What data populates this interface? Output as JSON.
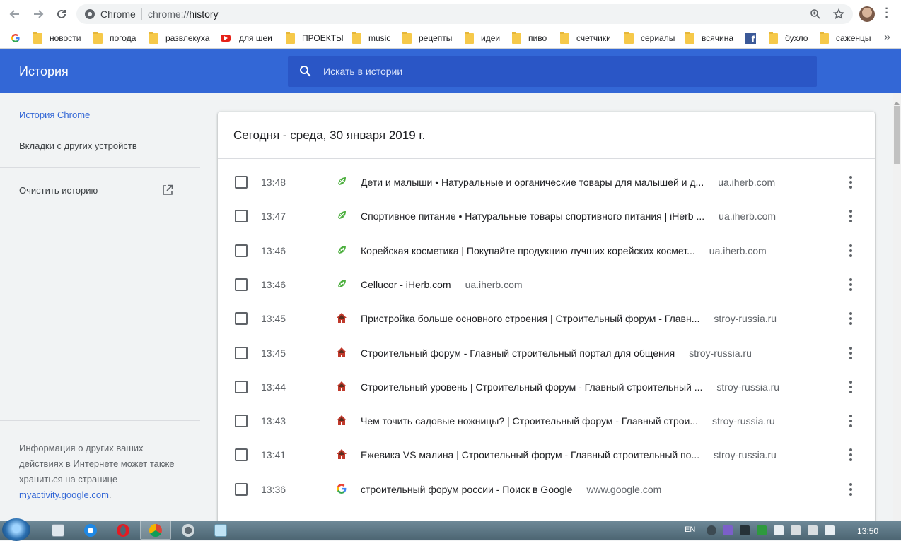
{
  "browser": {
    "site_chip": "Chrome",
    "url_prefix": "chrome://",
    "url_path": "history",
    "icons": [
      "back-icon",
      "forward-icon",
      "reload-icon",
      "zoom-icon",
      "bookmark-star-icon",
      "menu-icon"
    ]
  },
  "bookmarks": [
    {
      "label": "",
      "icon": "google-icon"
    },
    {
      "label": "новости",
      "icon": "folder-icon"
    },
    {
      "label": "погода",
      "icon": "folder-icon"
    },
    {
      "label": "развлекуха",
      "icon": "folder-icon"
    },
    {
      "label": "для шеи",
      "icon": "youtube-icon"
    },
    {
      "label": "ПРОЕКТЫ",
      "icon": "folder-icon"
    },
    {
      "label": "music",
      "icon": "folder-icon"
    },
    {
      "label": "рецепты",
      "icon": "folder-icon"
    },
    {
      "label": "идеи",
      "icon": "folder-icon"
    },
    {
      "label": "пиво",
      "icon": "folder-icon"
    },
    {
      "label": "счетчики",
      "icon": "folder-icon"
    },
    {
      "label": "сериалы",
      "icon": "folder-icon"
    },
    {
      "label": "всячина",
      "icon": "folder-icon"
    },
    {
      "label": "",
      "icon": "facebook-icon"
    },
    {
      "label": "бухло",
      "icon": "folder-icon"
    },
    {
      "label": "саженцы",
      "icon": "folder-icon"
    }
  ],
  "header": {
    "title": "История",
    "search_placeholder": "Искать в истории"
  },
  "sidebar": {
    "chrome_history": "История Chrome",
    "other_devices": "Вкладки с других устройств",
    "clear_history": "Очистить историю",
    "info_text": "Информация о других ваших действиях в Интернете может также храниться на странице",
    "info_link": "myactivity.google.com",
    "info_end": "."
  },
  "history": {
    "date_heading": "Сегодня - среда, 30 января 2019 г.",
    "items": [
      {
        "time": "13:48",
        "title": "Дети и малыши • Натуральные и органические товары для малышей и д...",
        "domain": "ua.iherb.com",
        "favicon": "iherb-leaf-icon"
      },
      {
        "time": "13:47",
        "title": "Спортивное питание • Натуральные товары спортивного питания | iHerb ...",
        "domain": "ua.iherb.com",
        "favicon": "iherb-leaf-icon"
      },
      {
        "time": "13:46",
        "title": "Корейская косметика | Покупайте продукцию лучших корейских космет...",
        "domain": "ua.iherb.com",
        "favicon": "iherb-leaf-icon"
      },
      {
        "time": "13:46",
        "title": "Cellucor - iHerb.com",
        "domain": "ua.iherb.com",
        "favicon": "iherb-leaf-icon"
      },
      {
        "time": "13:45",
        "title": "Пристройка больше основного строения | Строительный форум - Главн...",
        "domain": "stroy-russia.ru",
        "favicon": "house-icon"
      },
      {
        "time": "13:45",
        "title": "Строительный форум - Главный строительный портал для общения",
        "domain": "stroy-russia.ru",
        "favicon": "house-icon"
      },
      {
        "time": "13:44",
        "title": "Строительный уровень | Строительный форум - Главный строительный ...",
        "domain": "stroy-russia.ru",
        "favicon": "house-icon"
      },
      {
        "time": "13:43",
        "title": "Чем точить садовые ножницы? | Строительный форум - Главный строи...",
        "domain": "stroy-russia.ru",
        "favicon": "house-icon"
      },
      {
        "time": "13:41",
        "title": "Ежевика VS малина | Строительный форум - Главный строительный по...",
        "domain": "stroy-russia.ru",
        "favicon": "house-icon"
      },
      {
        "time": "13:36",
        "title": "строительный форум россии - Поиск в Google",
        "domain": "www.google.com",
        "favicon": "google-icon"
      }
    ]
  },
  "taskbar": {
    "language": "EN",
    "clock": "13:50"
  },
  "colors": {
    "header_blue": "#3367d6",
    "search_blue": "#2a56c6",
    "iherb_green": "#4caf3e",
    "stroy_red": "#c0392b"
  }
}
